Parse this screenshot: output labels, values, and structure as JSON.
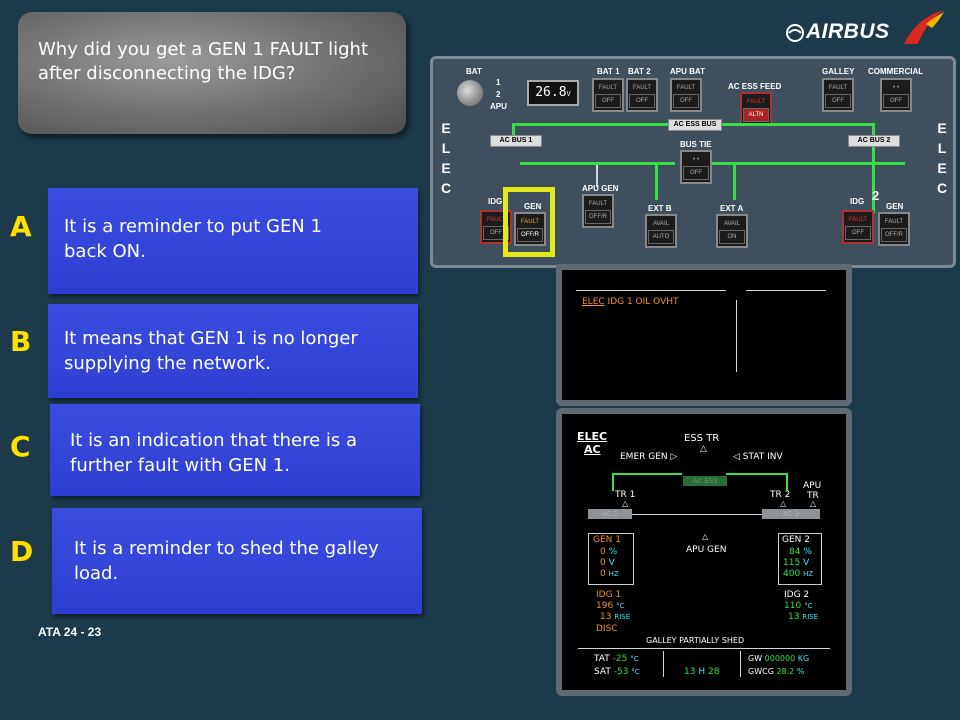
{
  "question": {
    "text": "Why did you get a GEN 1 FAULT light after disconnecting the IDG?"
  },
  "answers": [
    {
      "letter": "A",
      "text": "It is a reminder to put GEN 1 back ON."
    },
    {
      "letter": "B",
      "text": "It means that GEN 1 is no longer supplying the network."
    },
    {
      "letter": "C",
      "text": "It is an indication that there is a further fault with GEN 1."
    },
    {
      "letter": "D",
      "text": "It is a reminder to shed the galley load."
    }
  ],
  "footer": {
    "ata": "ATA 24 - 23"
  },
  "logo": {
    "text": "AIRBUS"
  },
  "colors": {
    "answer_box": "#3344dd",
    "letter": "#ffe000",
    "accent_green": "#36e046"
  },
  "panel": {
    "elec": [
      "E",
      "L",
      "E",
      "C"
    ],
    "labels": {
      "bat": "BAT",
      "bat1": "BAT 1",
      "bat2": "BAT 2",
      "apu_bat": "APU BAT",
      "ac_ess_feed": "AC ESS FEED",
      "galley": "GALLEY",
      "commercial": "COMMERCIAL",
      "ac_bus1": "AC BUS 1",
      "ac_bus2": "AC BUS 2",
      "ac_ess_bus": "AC ESS BUS",
      "bus_tie": "BUS TIE",
      "apu_gen": "APU GEN",
      "ext_b": "EXT B",
      "ext_a": "EXT A",
      "idg": "IDG",
      "gen": "GEN",
      "idg2": "IDG",
      "gen2": "GEN",
      "sel1": "1",
      "sel2": "2",
      "apu": "APU",
      "num2": "2"
    },
    "bat_value": "26.8",
    "bat_unit": "V",
    "btn": {
      "fault": "FAULT",
      "off": "OFF",
      "auto": "AUTO",
      "altn": "ALTN",
      "avail": "AVAIL",
      "offr": "OFF/R",
      "on": "ON"
    }
  },
  "ecam_upper": {
    "message_sys": "ELEC",
    "message_text": "IDG 1 OIL OVHT"
  },
  "ecam_lower": {
    "title": "ELEC",
    "subtitle": "AC",
    "ess_tr": "ESS TR",
    "emer_gen": "EMER GEN",
    "stat_inv": "STAT INV",
    "ac_ess": "AC ESS",
    "tr1": "TR 1",
    "tr2": "TR 2",
    "apu": "APU",
    "tr": "TR",
    "ac1": "AC 1",
    "ac2": "AC 2",
    "gen1": {
      "label": "GEN 1",
      "load": "0",
      "volt": "0",
      "freq": "0"
    },
    "gen2": {
      "label": "GEN 2",
      "load": "84",
      "volt": "115",
      "freq": "400"
    },
    "apu_gen": "APU GEN",
    "units": {
      "pct": "%",
      "v": "V",
      "hz": "HZ",
      "c": "°C",
      "rise": "RISE"
    },
    "idg1": {
      "label": "IDG 1",
      "temp": "196",
      "rise": "13"
    },
    "idg2": {
      "label": "IDG 2",
      "temp": "110",
      "rise": "13"
    },
    "disc": "DISC",
    "galley": "GALLEY PARTIALLY SHED",
    "tat_label": "TAT",
    "tat": "-25",
    "sat_label": "SAT",
    "sat": "-53",
    "time_h": "13",
    "time_sep": "H",
    "time_m": "28",
    "gw_label": "GW",
    "gw": "000000",
    "gw_unit": "KG",
    "gwcg_label": "GWCG",
    "gwcg": "28.2",
    "gwcg_unit": "%"
  }
}
